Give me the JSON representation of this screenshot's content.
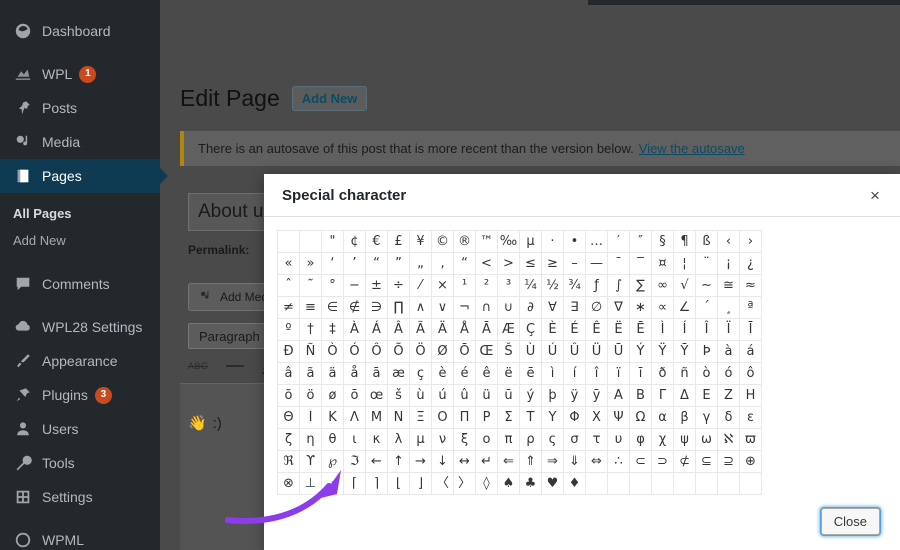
{
  "sidebar": {
    "items": [
      {
        "label": "Dashboard",
        "icon": "dashboard-icon",
        "badge": null,
        "active": false
      },
      {
        "label": "WPL",
        "icon": "chart-icon",
        "badge": "1",
        "active": false
      },
      {
        "label": "Posts",
        "icon": "pin-icon",
        "badge": null,
        "active": false
      },
      {
        "label": "Media",
        "icon": "media-icon",
        "badge": null,
        "active": false
      },
      {
        "label": "Pages",
        "icon": "pages-icon",
        "badge": null,
        "active": true
      }
    ],
    "submenu": [
      {
        "label": "All Pages",
        "current": true
      },
      {
        "label": "Add New",
        "current": false
      }
    ],
    "items_lower": [
      {
        "label": "Comments",
        "icon": "comment-icon",
        "badge": null
      },
      {
        "label": "WPL28 Settings",
        "icon": "cloud-icon",
        "badge": null
      },
      {
        "label": "Appearance",
        "icon": "brush-icon",
        "badge": null
      },
      {
        "label": "Plugins",
        "icon": "plug-icon",
        "badge": "3"
      },
      {
        "label": "Users",
        "icon": "user-icon",
        "badge": null
      },
      {
        "label": "Tools",
        "icon": "wrench-icon",
        "badge": null
      },
      {
        "label": "Settings",
        "icon": "settings-icon",
        "badge": null
      },
      {
        "label": "WPML",
        "icon": "globe-icon",
        "badge": null
      }
    ]
  },
  "page": {
    "title": "Edit Page",
    "add_new_label": "Add New",
    "notice_text": "There is an autosave of this post that is more recent than the version below.",
    "notice_link": "View the autosave",
    "post_title": "About u",
    "permalink_label": "Permalink:",
    "add_media_label": "Add Med",
    "format_select": "Paragraph",
    "strike_icon_label": "ABC",
    "editor_emoji": "👋",
    "editor_text": ":)"
  },
  "modal": {
    "title": "Special character",
    "close_icon": "×",
    "close_button_label": "Close",
    "columns": 22,
    "rows": [
      [
        " ",
        " ",
        "\"",
        "¢",
        "€",
        "£",
        "¥",
        "©",
        "®",
        "™",
        "‰",
        "µ",
        "·",
        "•",
        "…",
        "′",
        "″",
        "§",
        "¶",
        "ß",
        "‹",
        "›"
      ],
      [
        "«",
        "»",
        "‘",
        "’",
        "“",
        "”",
        "„",
        "‚",
        "“",
        "<",
        ">",
        "≤",
        "≥",
        "–",
        "—",
        "¯",
        "‾",
        "¤",
        "¦",
        "¨",
        "¡",
        "¿"
      ],
      [
        "ˆ",
        "˜",
        "°",
        "−",
        "±",
        "÷",
        "⁄",
        "×",
        "¹",
        "²",
        "³",
        "¼",
        "½",
        "¾",
        "ƒ",
        "∫",
        "∑",
        "∞",
        "√",
        "∼",
        "≅",
        "≈"
      ],
      [
        "≠",
        "≡",
        "∈",
        "∉",
        "∋",
        "∏",
        "∧",
        "∨",
        "¬",
        "∩",
        "∪",
        "∂",
        "∀",
        "∃",
        "∅",
        "∇",
        "∗",
        "∝",
        "∠",
        "´",
        "¸",
        "ª"
      ],
      [
        "º",
        "†",
        "‡",
        "À",
        "Á",
        "Â",
        "Ã",
        "Ä",
        "Å",
        "Ā",
        "Æ",
        "Ç",
        "È",
        "É",
        "Ê",
        "Ë",
        "Ē",
        "Ì",
        "Í",
        "Î",
        "Ï",
        "Ī"
      ],
      [
        "Ð",
        "Ñ",
        "Ò",
        "Ó",
        "Ô",
        "Õ",
        "Ö",
        "Ø",
        "Ō",
        "Œ",
        "Š",
        "Ù",
        "Ú",
        "Û",
        "Ü",
        "Ū",
        "Ý",
        "Ÿ",
        "Ȳ",
        "Þ",
        "à",
        "á"
      ],
      [
        "â",
        "ã",
        "ä",
        "å",
        "ā",
        "æ",
        "ç",
        "è",
        "é",
        "ê",
        "ë",
        "ē",
        "ì",
        "í",
        "î",
        "ï",
        "ī",
        "ð",
        "ñ",
        "ò",
        "ó",
        "ô"
      ],
      [
        "õ",
        "ö",
        "ø",
        "ō",
        "œ",
        "š",
        "ù",
        "ú",
        "û",
        "ü",
        "ū",
        "ý",
        "þ",
        "ÿ",
        "ȳ",
        "Α",
        "Β",
        "Γ",
        "Δ",
        "Ε",
        "Ζ",
        "Η"
      ],
      [
        "Θ",
        "Ι",
        "Κ",
        "Λ",
        "Μ",
        "Ν",
        "Ξ",
        "Ο",
        "Π",
        "Ρ",
        "Σ",
        "Τ",
        "Υ",
        "Φ",
        "Χ",
        "Ψ",
        "Ω",
        "α",
        "β",
        "γ",
        "δ",
        "ε"
      ],
      [
        "ζ",
        "η",
        "θ",
        "ι",
        "κ",
        "λ",
        "μ",
        "ν",
        "ξ",
        "ο",
        "π",
        "ρ",
        "ς",
        "σ",
        "τ",
        "υ",
        "φ",
        "χ",
        "ψ",
        "ω",
        "ℵ",
        "ϖ"
      ],
      [
        "ℜ",
        "ϒ",
        "℘",
        "ℑ",
        "←",
        "↑",
        "→",
        "↓",
        "↔",
        "↵",
        "⇐",
        "⇑",
        "⇒",
        "⇓",
        "⇔",
        "∴",
        "⊂",
        "⊃",
        "⊄",
        "⊆",
        "⊇",
        "⊕"
      ],
      [
        "⊗",
        "⊥",
        "⋅",
        "⌈",
        "⌉",
        "⌊",
        "⌋",
        "〈",
        "〉",
        "◊",
        "♠",
        "♣",
        "♥",
        "♦",
        "",
        "",
        "",
        "",
        "",
        "",
        "",
        ""
      ]
    ],
    "highlighted_char": "♥"
  },
  "colors": {
    "sidebar_bg": "#23282d",
    "sidebar_active": "#0f3b52",
    "badge": "#ca4a1f",
    "annotation": "#8b3dea",
    "link": "#0b4a63",
    "focus_ring": "#5b9dd9"
  }
}
